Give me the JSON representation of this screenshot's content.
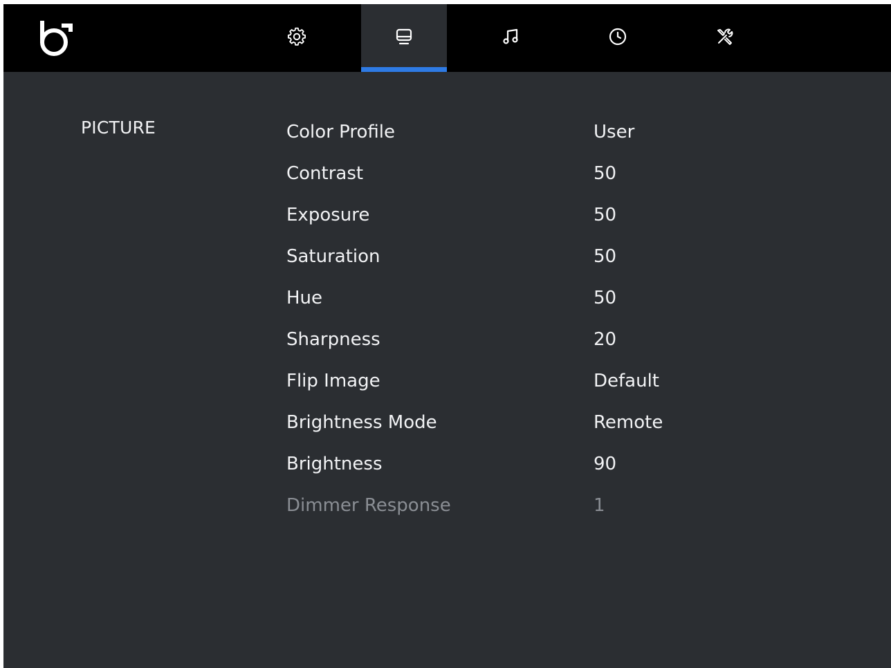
{
  "nav": {
    "logo_icon": "brand-logo-icon",
    "tabs": [
      {
        "id": "settings",
        "icon": "gear-icon",
        "active": false
      },
      {
        "id": "display",
        "icon": "monitor-icon",
        "active": true
      },
      {
        "id": "audio",
        "icon": "music-note-icon",
        "active": false
      },
      {
        "id": "schedule",
        "icon": "clock-icon",
        "active": false
      },
      {
        "id": "tools",
        "icon": "tools-icon",
        "active": false
      }
    ],
    "accent_color": "#2e7be5"
  },
  "section": {
    "title": "PICTURE"
  },
  "settings": [
    {
      "label": "Color Profile",
      "value": "User",
      "enabled": true
    },
    {
      "label": "Contrast",
      "value": "50",
      "enabled": true
    },
    {
      "label": "Exposure",
      "value": "50",
      "enabled": true
    },
    {
      "label": "Saturation",
      "value": "50",
      "enabled": true
    },
    {
      "label": "Hue",
      "value": "50",
      "enabled": true
    },
    {
      "label": "Sharpness",
      "value": "20",
      "enabled": true
    },
    {
      "label": "Flip Image",
      "value": "Default",
      "enabled": true
    },
    {
      "label": "Brightness Mode",
      "value": "Remote",
      "enabled": true
    },
    {
      "label": "Brightness",
      "value": "90",
      "enabled": true
    },
    {
      "label": "Dimmer Response",
      "value": "1",
      "enabled": false
    }
  ]
}
